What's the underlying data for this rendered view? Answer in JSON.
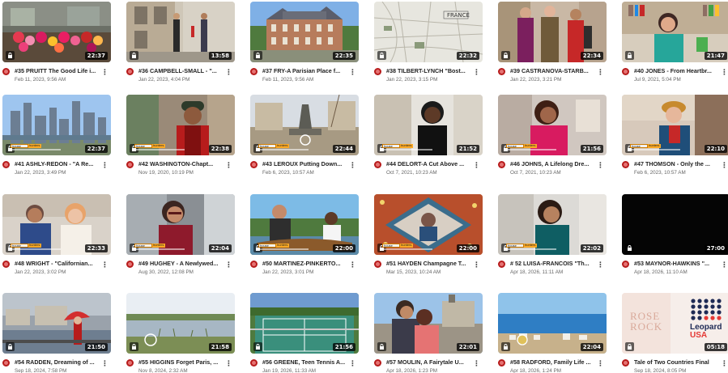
{
  "videos": [
    {
      "title": "#35 PRUITT The Good Life i...",
      "date": "Feb 11, 2023, 9:56 AM",
      "duration": "22:37",
      "art": "flowers"
    },
    {
      "title": "#36 CAMPBELL-SMALL - \"...",
      "date": "Jan 22, 2023, 4:04 PM",
      "duration": "13:58",
      "art": "street"
    },
    {
      "title": "#37 FRY-A Parisian Place f...",
      "date": "Feb 11, 2023, 9:56 AM",
      "duration": "22:35",
      "art": "chateau"
    },
    {
      "title": "#38 TILBERT-LYNCH \"Bost...",
      "date": "Jan 22, 2023, 3:15 PM",
      "duration": "22:32",
      "art": "map"
    },
    {
      "title": "#39 CASTRANOVA-STARB...",
      "date": "Jan 22, 2023, 3:21 PM",
      "duration": "22:34",
      "art": "trio"
    },
    {
      "title": "#40 JONES - From Heartbr...",
      "date": "Jul 9, 2021, 5:04 PM",
      "duration": "21:47",
      "art": "woman-books"
    },
    {
      "title": "#41 ASHLY-REDON - \"A Re...",
      "date": "Jan 22, 2023, 3:49 PM",
      "duration": "22:37",
      "art": "skyline"
    },
    {
      "title": "#42 WASHINGTON-Chapt...",
      "date": "Nov 19, 2020, 10:19 PM",
      "duration": "22:38",
      "art": "man-beanie"
    },
    {
      "title": "#43 LEROUX Putting Down...",
      "date": "Feb 6, 2023, 10:57 AM",
      "duration": "22:44",
      "art": "fountain"
    },
    {
      "title": "#44 DELORT-A Cut Above ...",
      "date": "Oct 7, 2021, 10:23 AM",
      "duration": "21:52",
      "art": "woman-dark"
    },
    {
      "title": "#46 JOHNS, A Lifelong Dre...",
      "date": "Oct 7, 2021, 10:23 AM",
      "duration": "21:56",
      "art": "woman-red"
    },
    {
      "title": "#47 THOMSON - Only the ...",
      "date": "Feb 6, 2023, 10:57 AM",
      "duration": "22:10",
      "art": "woman-hat"
    },
    {
      "title": "#48 WRIGHT - \"Californian...",
      "date": "Jan 22, 2023, 3:02 PM",
      "duration": "22:33",
      "art": "couple"
    },
    {
      "title": "#49 HUGHEY - A Newlywed...",
      "date": "Aug 30, 2022, 12:08 PM",
      "duration": "22:04",
      "art": "woman-glasses"
    },
    {
      "title": "#50 MARTINEZ-PINKERTO...",
      "date": "Jan 22, 2023, 3:01 PM",
      "duration": "22:00",
      "art": "boat"
    },
    {
      "title": "#51 HAYDEN Champagne T...",
      "date": "Mar 15, 2023, 10:24 AM",
      "duration": "22:00",
      "art": "frame"
    },
    {
      "title": "# 52 LUISA-FRANCOIS \"Th...",
      "date": "Apr 18, 2026, 11:11 AM",
      "duration": "22:02",
      "art": "woman-teal"
    },
    {
      "title": "#53 MAYNOR-HAWKINS \"...",
      "date": "Apr 18, 2026, 11:10 AM",
      "duration": "27:00",
      "art": "black"
    },
    {
      "title": "#54 RADDEN, Dreaming of ...",
      "date": "Sep 18, 2024, 7:58 PM",
      "duration": "21:50",
      "art": "umbrella"
    },
    {
      "title": "#55 HIGGINS Forget Paris, ...",
      "date": "Nov 8, 2024, 2:32 AM",
      "duration": "21:58",
      "art": "lake"
    },
    {
      "title": "#56 GREENE, Teen Tennis A...",
      "date": "Jan 19, 2026, 11:33 AM",
      "duration": "21:56",
      "art": "tennis"
    },
    {
      "title": "#57 MOULIN, A Fairytale U...",
      "date": "Apr 18, 2026, 1:23 PM",
      "duration": "22:01",
      "art": "kiss"
    },
    {
      "title": "#58 RADFORD, Family Life ...",
      "date": "Apr 18, 2026, 1:24 PM",
      "duration": "22:04",
      "art": "coast"
    },
    {
      "title": "Tale of Two Countries Final",
      "date": "Sep 18, 2024, 8:05 PM",
      "duration": "05:18",
      "art": "leopard",
      "logo_text": [
        "ROSE",
        "ROCK"
      ],
      "logo_brand": [
        "Leopard",
        "USA"
      ]
    }
  ],
  "house_hunters": {
    "line1": "house",
    "line2": "hunters"
  },
  "more_glyph": "⋮"
}
